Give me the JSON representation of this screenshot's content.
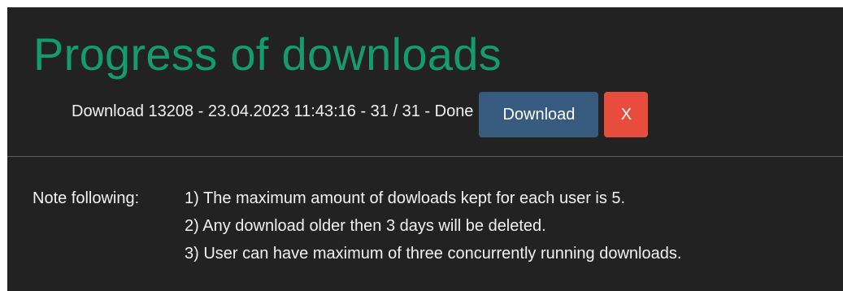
{
  "page": {
    "title": "Progress of downloads"
  },
  "download": {
    "text": "Download 13208 - 23.04.2023 11:43:16 - 31 / 31 - Done",
    "download_button_label": "Download",
    "close_button_label": "X"
  },
  "notes": {
    "label": "Note following:",
    "items": [
      "1) The maximum amount of dowloads kept for each user is 5.",
      "2) Any download older then 3 days will be deleted.",
      "3) User can have maximum of three concurrently running downloads."
    ]
  },
  "colors": {
    "background": "#222222",
    "title": "#149c6e",
    "download_button": "#375a7f",
    "close_button": "#e74c3c",
    "text": "#f2f2f2"
  }
}
